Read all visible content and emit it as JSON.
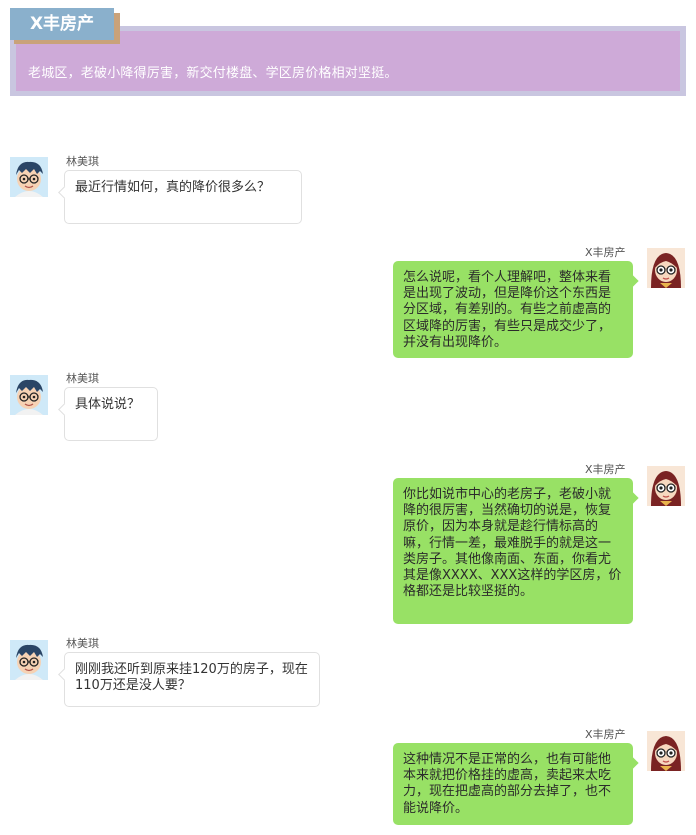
{
  "header": {
    "title": "X丰房产",
    "subtitle": "老城区，老破小降得厉害，新交付楼盘、学区房价格相对坚挺。"
  },
  "messages": [
    {
      "sender": "林美琪",
      "side": "left",
      "text": "最近行情如何，真的降价很多么？"
    },
    {
      "sender": "X丰房产",
      "side": "right",
      "text": "怎么说呢，看个人理解吧，整体来看是出现了波动，但是降价这个东西是分区域，有差别的。有些之前虚高的区域降的厉害，有些只是成交少了，并没有出现降价。"
    },
    {
      "sender": "林美琪",
      "side": "left",
      "text": "具体说说？"
    },
    {
      "sender": "X丰房产",
      "side": "right",
      "text": "你比如说市中心的老房子，老破小就降的很厉害，当然确切的说是，恢复原价，因为本身就是趁行情标高的嘛，行情一差，最难脱手的就是这一类房子。其他像南面、东面，你看尤其是像XXXX、XXX这样的学区房，价格都还是比较坚挺的。"
    },
    {
      "sender": "林美琪",
      "side": "left",
      "text": "刚刚我还听到原来挂120万的房子，现在110万还是没人要？"
    },
    {
      "sender": "X丰房产",
      "side": "right",
      "text": "这种情况不是正常的么，也有可能他本来就把价格挂的虚高，卖起来太吃力，现在把虚高的部分去掉了，也不能说降价。"
    }
  ]
}
